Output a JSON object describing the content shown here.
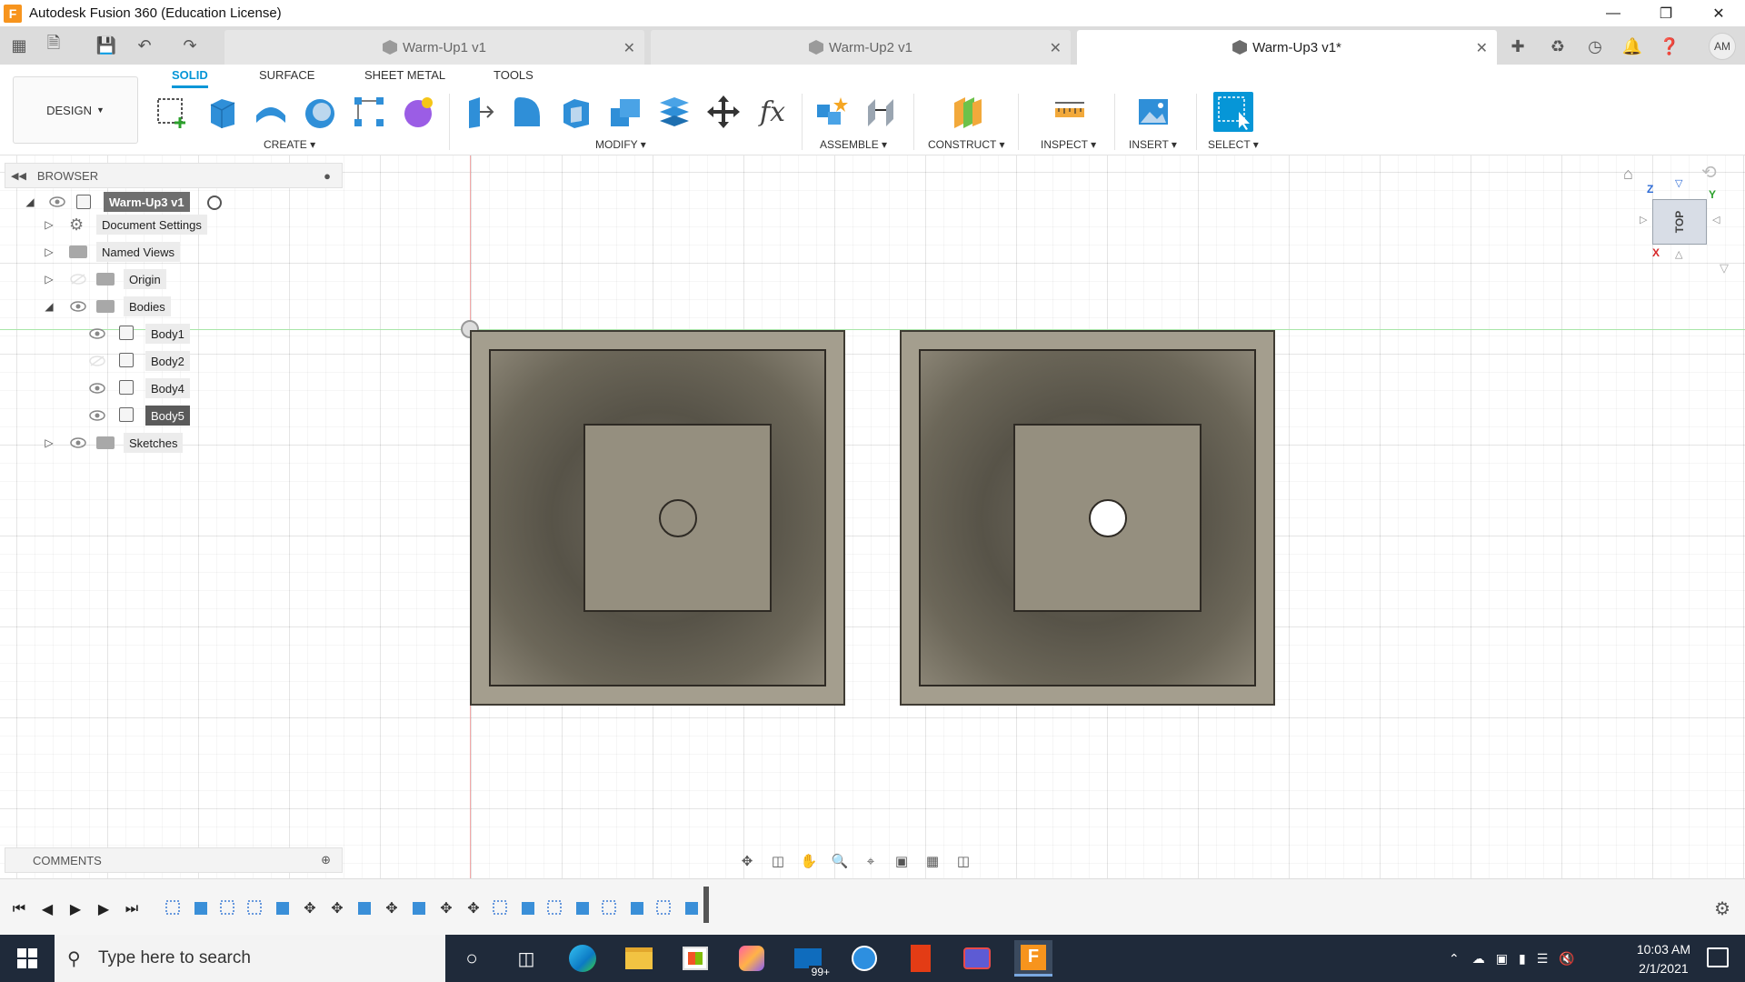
{
  "window": {
    "title": "Autodesk Fusion 360 (Education License)",
    "logo_letter": "F"
  },
  "tabs": [
    {
      "label": "Warm-Up1 v1"
    },
    {
      "label": "Warm-Up2 v1"
    },
    {
      "label": "Warm-Up3 v1*",
      "active": true
    }
  ],
  "profile": {
    "initials": "AM"
  },
  "ribbon": {
    "workspace": "DESIGN",
    "tabs": [
      "SOLID",
      "SURFACE",
      "SHEET METAL",
      "TOOLS"
    ],
    "active_tab": "SOLID",
    "groups": [
      "CREATE",
      "MODIFY",
      "ASSEMBLE",
      "CONSTRUCT",
      "INSPECT",
      "INSERT",
      "SELECT"
    ],
    "function_label": "fx"
  },
  "browser": {
    "title": "BROWSER",
    "root": "Warm-Up3 v1",
    "items": [
      {
        "label": "Document Settings"
      },
      {
        "label": "Named Views"
      },
      {
        "label": "Origin"
      },
      {
        "label": "Bodies"
      },
      {
        "label": "Body1"
      },
      {
        "label": "Body2"
      },
      {
        "label": "Body4"
      },
      {
        "label": "Body5",
        "selected": true
      },
      {
        "label": "Sketches"
      }
    ]
  },
  "comments": {
    "title": "COMMENTS"
  },
  "viewcube": {
    "face": "TOP",
    "axes": [
      "Z",
      "Y",
      "X"
    ]
  },
  "taskbar": {
    "search_placeholder": "Type here to search",
    "mail_badge": "99+",
    "time": "10:03 AM",
    "date": "2/1/2021"
  },
  "colors": {
    "accent": "#0696d7",
    "body_fill": "#a49e8e",
    "taskbar": "#1f2a3a"
  }
}
